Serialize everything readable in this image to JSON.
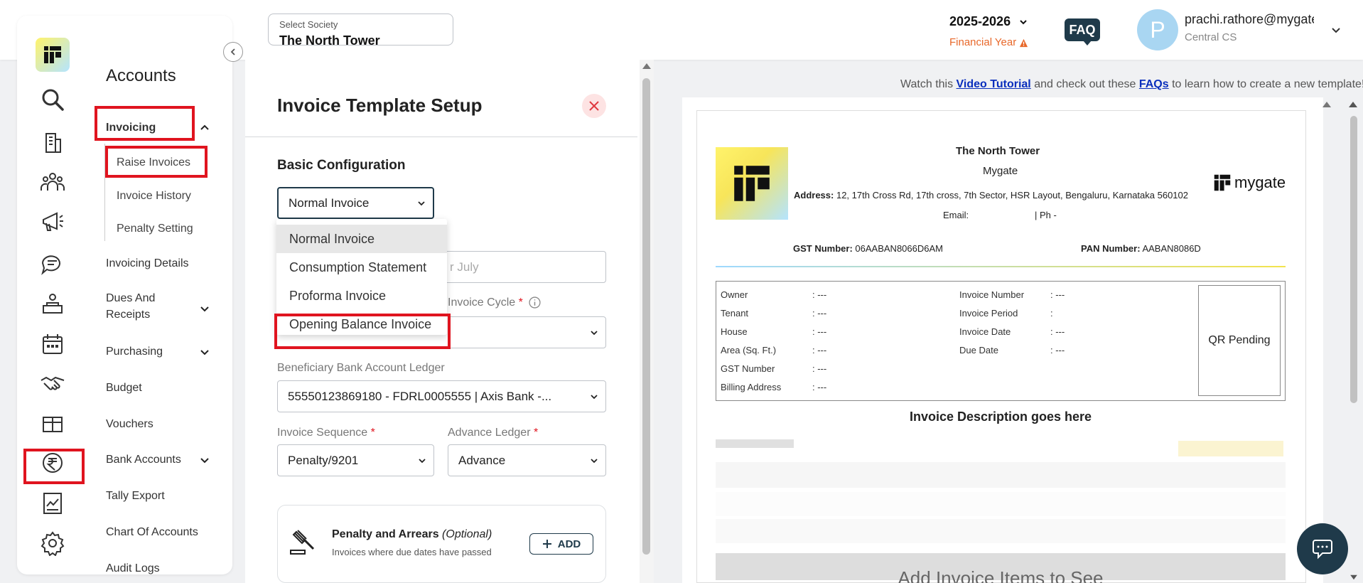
{
  "header": {
    "society_label": "Select Society",
    "society_value": "The North Tower",
    "year": "2025-2026",
    "year_sub": "Financial Year",
    "faq": "FAQ",
    "avatar_letter": "P",
    "email": "prachi.rathore@mygate",
    "role": "Central CS"
  },
  "sidebar": {
    "section_title": "Accounts",
    "items": {
      "invoicing": "Invoicing",
      "raise_invoices": "Raise Invoices",
      "invoice_history": "Invoice History",
      "penalty_setting": "Penalty Setting",
      "invoicing_details": "Invoicing Details",
      "dues_line1": "Dues And",
      "dues_line2": "Receipts",
      "purchasing": "Purchasing",
      "budget": "Budget",
      "vouchers": "Vouchers",
      "bank_accounts": "Bank Accounts",
      "tally_export": "Tally Export",
      "chart_of_accounts": "Chart Of Accounts",
      "audit_logs": "Audit Logs"
    }
  },
  "form": {
    "title": "Invoice Template Setup",
    "section": "Basic Configuration",
    "invoice_type_value": "Normal Invoice",
    "dropdown_options": [
      "Normal Invoice",
      "Consumption Statement",
      "Proforma Invoice",
      "Opening Balance Invoice"
    ],
    "name_placeholder_tail": "r July",
    "invoice_cycle_label": "Invoice Cycle",
    "bank_label": "Beneficiary Bank Account Ledger",
    "bank_value": "55550123869180 - FDRL0005555 | Axis Bank -...",
    "sequence_label": "Invoice Sequence",
    "sequence_value": "Penalty/9201",
    "advance_label": "Advance Ledger",
    "advance_value": "Advance",
    "required_mark": "*",
    "penalty_title": "Penalty and Arrears",
    "penalty_optional": "(Optional)",
    "penalty_desc": "Invoices where due dates have passed",
    "add_label": "ADD"
  },
  "preview": {
    "help_pre": "Watch this ",
    "help_link1": "Video Tutorial",
    "help_mid": " and check out these ",
    "help_link2": "FAQs",
    "help_post": " to learn how to create a new template!",
    "society_name": "The North Tower",
    "sub_name": "Mygate",
    "address_label": "Address:",
    "address_value": " 12, 17th Cross Rd, 17th cross, 7th Sector, HSR Layout, Bengaluru, Karnataka 560102",
    "email_line": "Email:",
    "phone_line": "| Ph -",
    "brand": "mygate",
    "gst_label": "GST Number:",
    "gst_value": " 06AABAN8066D6AM",
    "pan_label": "PAN Number:",
    "pan_value": " AABAN8086D",
    "left_fields": [
      {
        "k": "Owner",
        "v": ":  ---"
      },
      {
        "k": "Tenant",
        "v": ":  ---"
      },
      {
        "k": "House",
        "v": ":  ---"
      },
      {
        "k": "Area (Sq. Ft.)",
        "v": ":  ---"
      },
      {
        "k": "GST Number",
        "v": ":  ---"
      },
      {
        "k": "Billing Address",
        "v": ":  ---"
      }
    ],
    "right_fields": [
      {
        "k": "Invoice Number",
        "v": ":  ---"
      },
      {
        "k": "Invoice Period",
        "v": ":"
      },
      {
        "k": "Invoice Date",
        "v": ":  ---"
      },
      {
        "k": "Due Date",
        "v": ":  ---"
      }
    ],
    "qr_text": "QR Pending",
    "desc_title": "Invoice Description goes here",
    "add_items_text": "Add Invoice Items to See"
  },
  "colors": {
    "highlight": "#e0141f",
    "accent_dark": "#1f3a4a",
    "warning": "#e8682a"
  }
}
